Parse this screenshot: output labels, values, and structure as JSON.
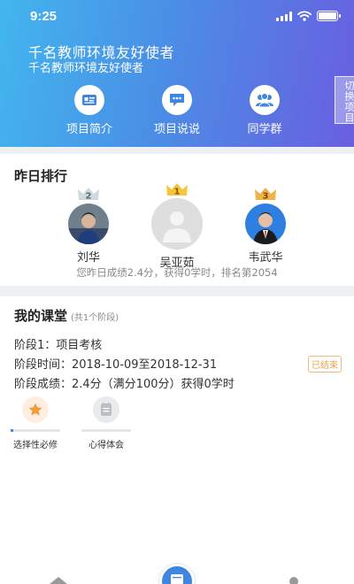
{
  "status_bar": {
    "time": "9:25"
  },
  "header": {
    "title": "千名教师环境友好使者",
    "subtitle": "千名教师环境友好使者",
    "switch_label": "切换项目",
    "nav": [
      {
        "label": "项目简介",
        "icon": "id-card-icon"
      },
      {
        "label": "项目说说",
        "icon": "chat-bubble-icon"
      },
      {
        "label": "同学群",
        "icon": "group-icon"
      }
    ]
  },
  "ranking": {
    "title": "昨日排行",
    "podium": [
      {
        "rank": "2",
        "name": "刘华"
      },
      {
        "rank": "1",
        "name": "吴亚茹"
      },
      {
        "rank": "3",
        "name": "韦武华"
      }
    ],
    "summary": "您昨日成绩2.4分，获得0学时，排名第2054"
  },
  "classroom": {
    "title": "我的课堂",
    "count_note": "(共1个阶段)",
    "stage": "阶段1：项目考核",
    "stage_time": "阶段时间：2018-10-09至2018-12-31",
    "stage_score": "阶段成绩：2.4分（满分100分）获得0学时",
    "status_badge": "已结束",
    "modules": [
      {
        "label": "选择性必修",
        "icon": "star-icon",
        "progress": 0.05
      },
      {
        "label": "心得体会",
        "icon": "notebook-icon",
        "progress": 0
      }
    ]
  },
  "colors": {
    "accent": "#3e86e0",
    "header_gradient_start": "#42b6ee",
    "header_gradient_end": "#6a5ee0",
    "badge_orange": "#e8a04a",
    "star_orange": "#f29a3a"
  }
}
